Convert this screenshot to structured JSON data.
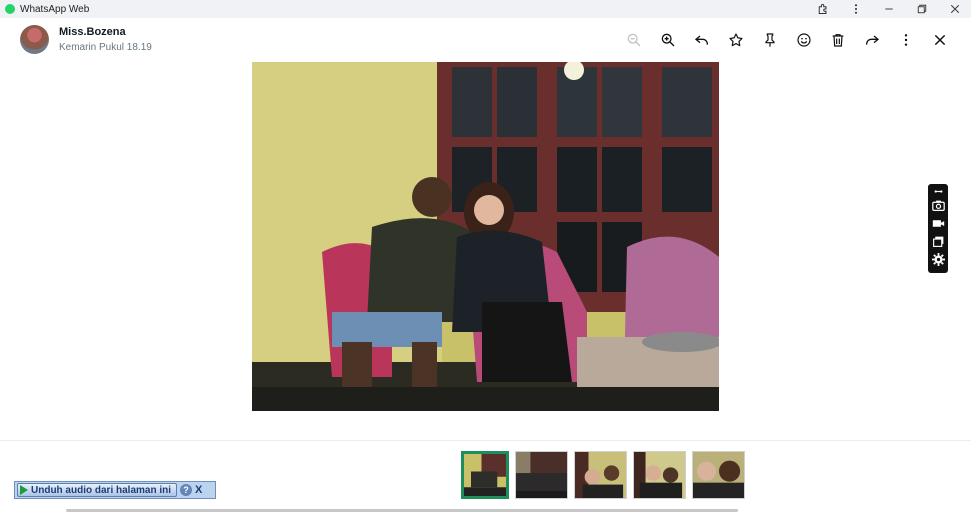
{
  "window": {
    "title": "WhatsApp Web",
    "icons": [
      "extensions-icon",
      "kebab-menu-icon",
      "minimize-icon",
      "restore-icon",
      "close-icon"
    ]
  },
  "header": {
    "sender_name": "Miss.Bozena",
    "timestamp": "Kemarin Pukul 18.19",
    "actions": [
      {
        "name": "zoom-out-icon",
        "enabled": false
      },
      {
        "name": "zoom-in-icon",
        "enabled": true
      },
      {
        "name": "reply-icon",
        "enabled": true
      },
      {
        "name": "star-icon",
        "enabled": true
      },
      {
        "name": "pin-icon",
        "enabled": true
      },
      {
        "name": "emoji-icon",
        "enabled": true
      },
      {
        "name": "delete-icon",
        "enabled": true
      },
      {
        "name": "forward-icon",
        "enabled": true
      },
      {
        "name": "menu-icon",
        "enabled": true
      },
      {
        "name": "close-viewer-icon",
        "enabled": true
      }
    ]
  },
  "side_tools": [
    "screenshot-icon",
    "video-record-icon",
    "window-capture-icon",
    "settings-icon"
  ],
  "thumbnails": [
    {
      "active": true
    },
    {
      "active": false
    },
    {
      "active": false
    },
    {
      "active": false
    },
    {
      "active": false
    }
  ],
  "audio_widget": {
    "button_label": "Unduh audio dari halaman ini",
    "help_label": "?",
    "close_label": "X"
  },
  "colors": {
    "accent": "#1e8f5a",
    "whatsapp_green": "#25d366",
    "text_secondary": "#667781"
  }
}
